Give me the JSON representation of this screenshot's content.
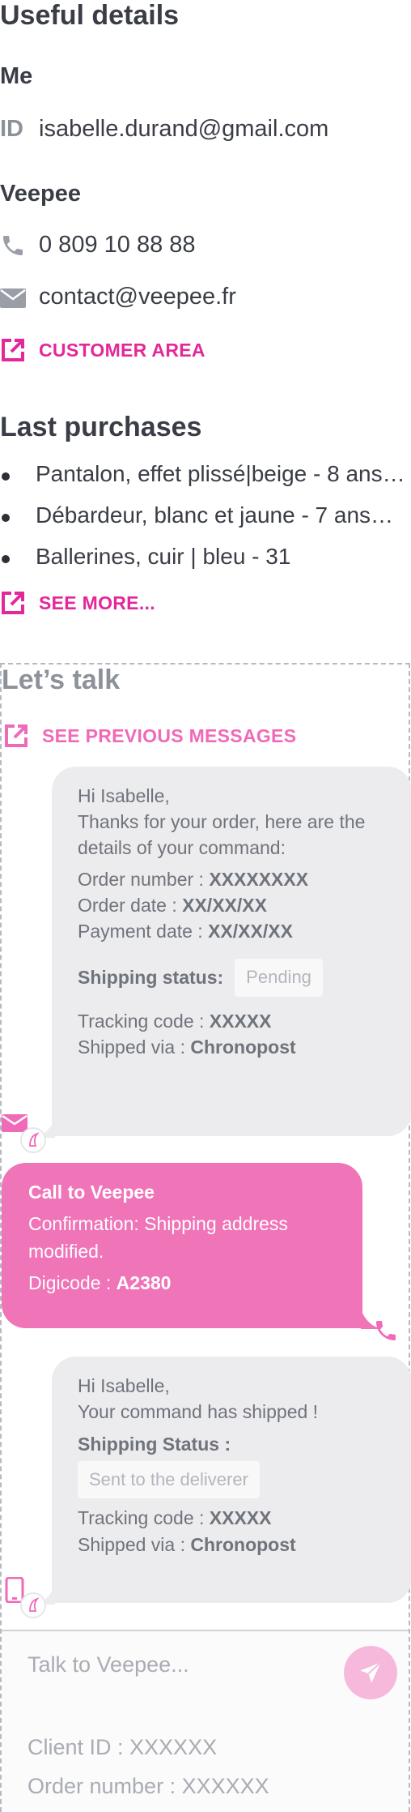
{
  "details": {
    "title": "Useful details",
    "me_heading": "Me",
    "id_label": "ID",
    "email": "isabelle.durand@gmail.com",
    "veepee_heading": "Veepee",
    "phone": "0 809 10 88 88",
    "contact_email": "contact@veepee.fr",
    "customer_area_label": "CUSTOMER AREA"
  },
  "purchases": {
    "title": "Last purchases",
    "items": [
      "Pantalon, effet plissé|beige - 8 ans…",
      "Débardeur, blanc et jaune - 7 ans…",
      "Ballerines, cuir | bleu - 31"
    ],
    "see_more_label": "SEE MORE..."
  },
  "chat": {
    "title": "Let’s talk",
    "previous_label": "SEE PREVIOUS MESSAGES",
    "msg1": {
      "greeting": "Hi Isabelle,",
      "intro": "Thanks for your order, here are the details of your command:",
      "order_number_label": "Order number : ",
      "order_number": "XXXXXXXX",
      "order_date_label": "Order date : ",
      "order_date": "XX/XX/XX",
      "payment_date_label": "Payment date : ",
      "payment_date": "XX/XX/XX",
      "shipping_status_label": "Shipping status:",
      "shipping_status": "Pending",
      "tracking_label": "Tracking code : ",
      "tracking": "XXXXX",
      "shipped_via_label": "Shipped via : ",
      "carrier": "Chronopost"
    },
    "msg2": {
      "title": "Call to Veepee",
      "text": "Confirmation: Shipping address modified.",
      "digicode_label": "Digicode : ",
      "digicode": "A2380"
    },
    "msg3": {
      "greeting": "Hi Isabelle,",
      "text": "Your command has shipped !",
      "shipping_status_label": "Shipping Status :",
      "shipping_status": "Sent to the deliverer",
      "tracking_label": "Tracking code : ",
      "tracking": "XXXXX",
      "shipped_via_label": "Shipped via : ",
      "carrier": "Chronopost"
    },
    "composer": {
      "placeholder": "Talk to Veepee...",
      "client_id": "Client ID : XXXXXX",
      "order_number": "Order number : XXXXXX"
    }
  },
  "colors": {
    "accent_pink": "#e3289a",
    "bubble_pink": "#f074b8",
    "bubble_gray": "#ececee",
    "text_dark": "#3a3d46",
    "text_gray": "#8d919a"
  },
  "icons": [
    "phone-icon",
    "envelope-icon",
    "external-link-icon",
    "mail-channel-icon",
    "agent-avatar-icon",
    "mobile-channel-icon",
    "send-icon"
  ]
}
